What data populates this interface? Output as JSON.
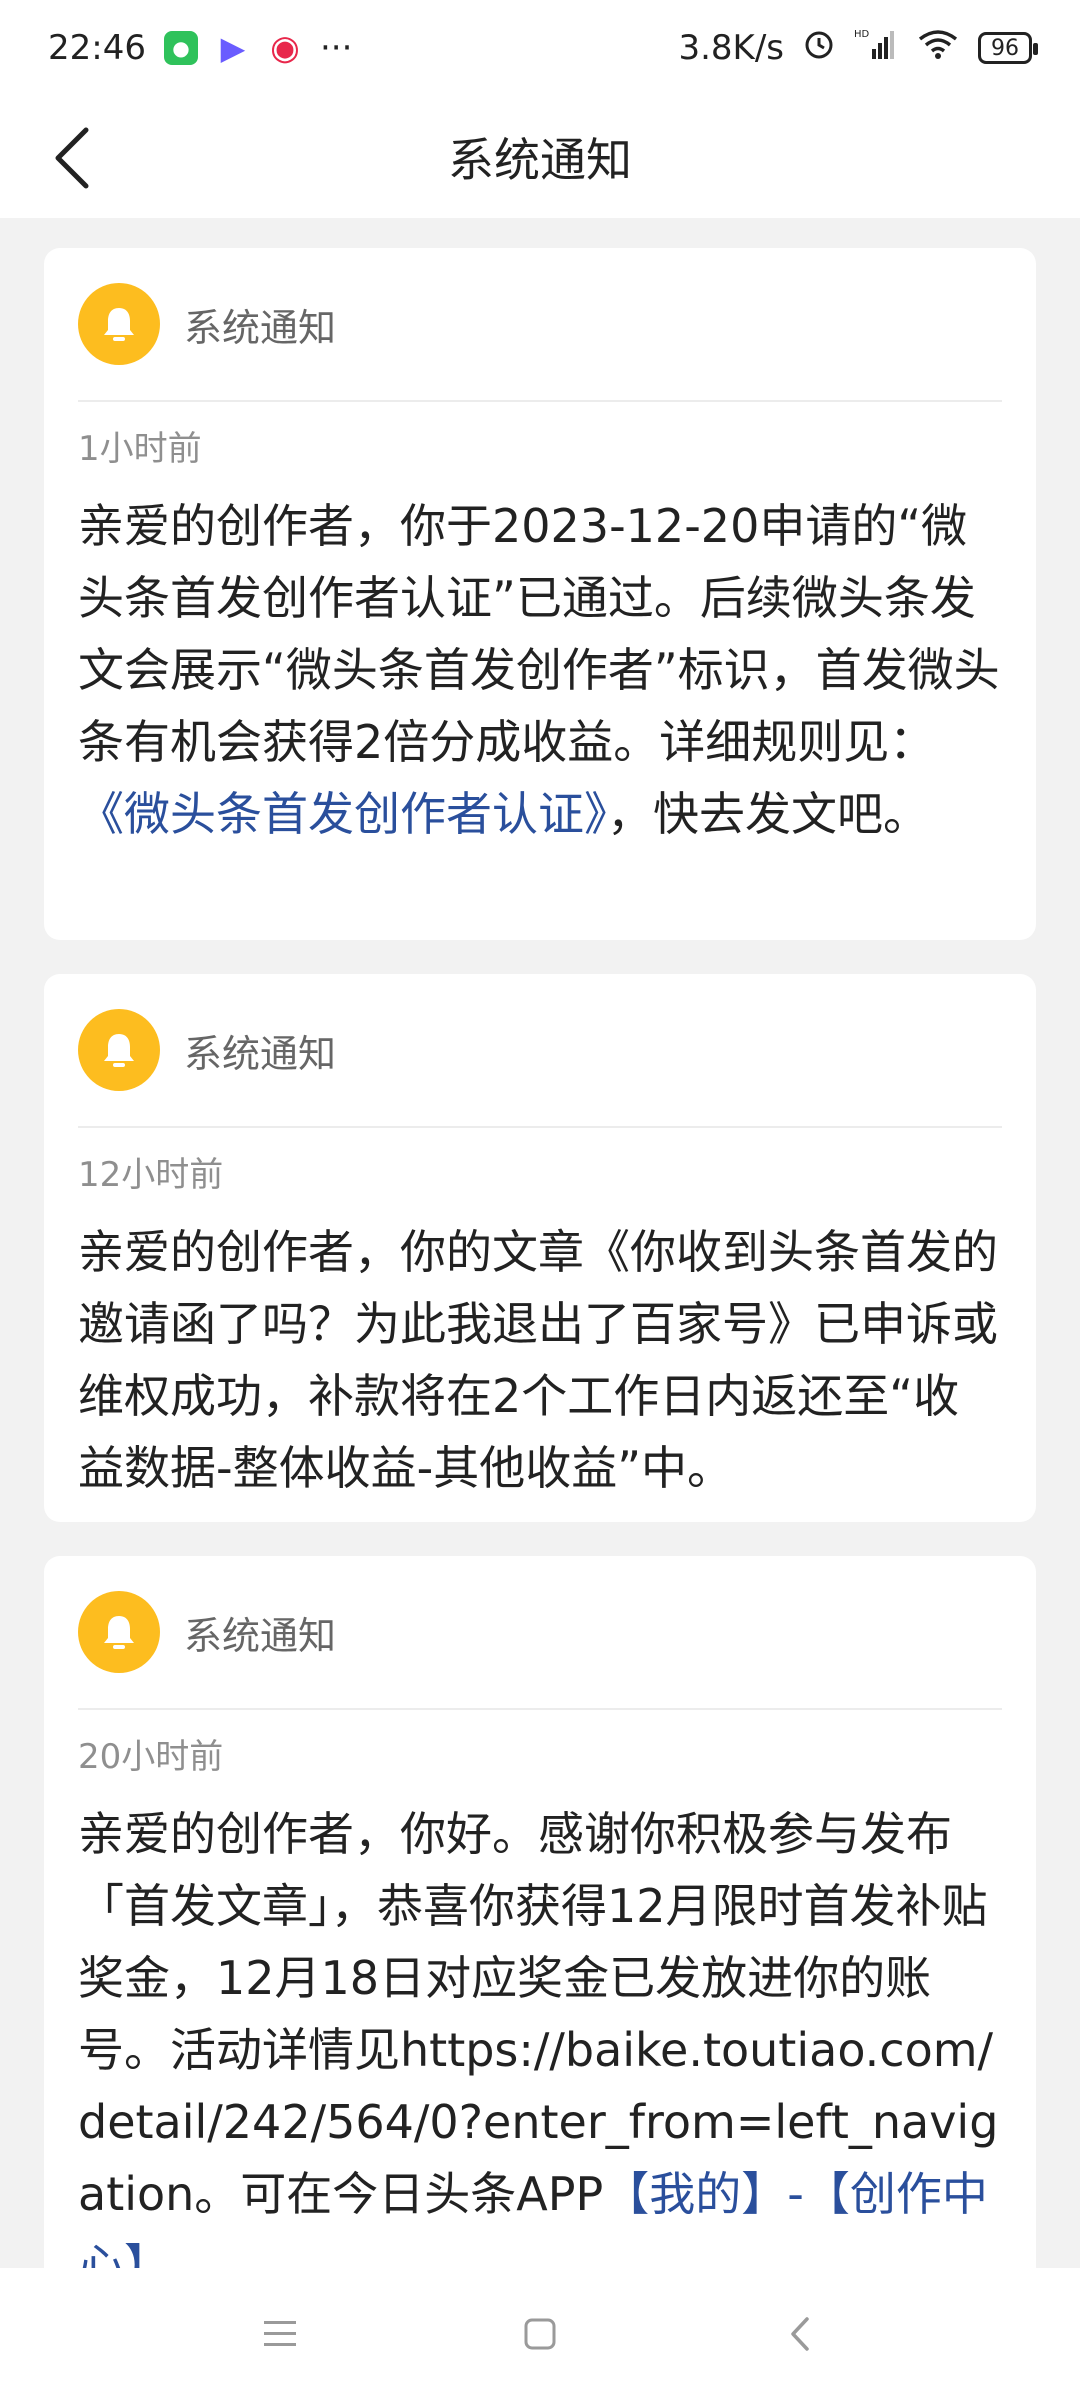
{
  "status": {
    "time": "22:46",
    "net_speed": "3.8K/s",
    "hd": "HD",
    "battery": "96",
    "more": "···"
  },
  "header": {
    "title": "系统通知"
  },
  "notifications": [
    {
      "source": "系统通知",
      "time": "1小时前",
      "text_before": "亲爱的创作者，你于2023-12-20申请的“微头条首发创作者认证”已通过。后续微头条发文会展示“微头条首发创作者”标识，首发微头条有机会获得2倍分成收益。详细规则见：",
      "link": "《微头条首发创作者认证》",
      "text_after": "，快去发文吧。"
    },
    {
      "source": "系统通知",
      "time": "12小时前",
      "text": "亲爱的创作者，你的文章《你收到头条首发的邀请函了吗？为此我退出了百家号》已申诉或维权成功，补款将在2个工作日内返还至“收益数据-整体收益-其他收益”中。"
    },
    {
      "source": "系统通知",
      "time": "20小时前",
      "text_before": "亲爱的创作者，你好。感谢你积极参与发布「首发文章」，恭喜你获得12月限时首发补贴奖金，12月18日对应奖金已发放进你的账号。活动详情见https://baike.toutiao.com/detail/242/564/0?enter_from=left_navigation。可在今日头条APP",
      "link": "【我的】-【创作中心】"
    }
  ]
}
